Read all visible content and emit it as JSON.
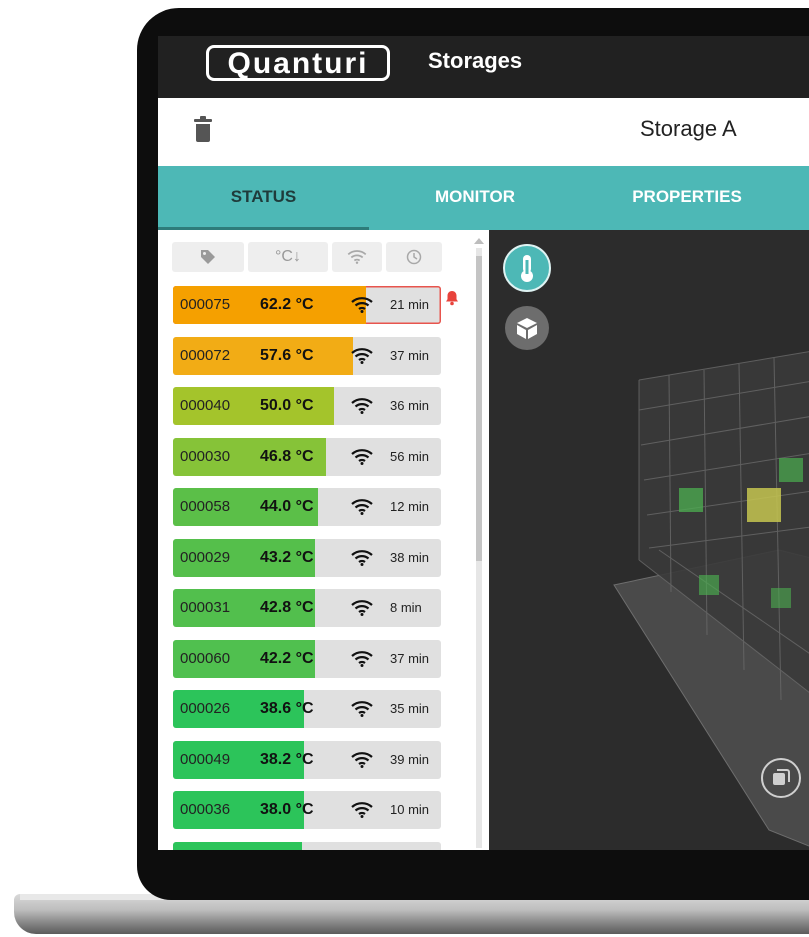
{
  "app": {
    "logo": "Quanturi",
    "title": "Storages"
  },
  "storage": {
    "name": "Storage A"
  },
  "tabs": [
    {
      "label": "STATUS",
      "active": true
    },
    {
      "label": "MONITOR",
      "active": false
    },
    {
      "label": "PROPERTIES",
      "active": false
    }
  ],
  "filters": {
    "temp_sort_label": "°C↓"
  },
  "sensors": [
    {
      "id": "000075",
      "temp": "62.2 °C",
      "time": "21 min",
      "fill": 0.72,
      "color": "#f5a000",
      "alert": true
    },
    {
      "id": "000072",
      "temp": "57.6 °C",
      "time": "37 min",
      "fill": 0.67,
      "color": "#f2ac15",
      "alert": false
    },
    {
      "id": "000040",
      "temp": "50.0 °C",
      "time": "36 min",
      "fill": 0.6,
      "color": "#a4c42b",
      "alert": false
    },
    {
      "id": "000030",
      "temp": "46.8 °C",
      "time": "56 min",
      "fill": 0.57,
      "color": "#86c338",
      "alert": false
    },
    {
      "id": "000058",
      "temp": "44.0 °C",
      "time": "12 min",
      "fill": 0.54,
      "color": "#5bbf48",
      "alert": false
    },
    {
      "id": "000029",
      "temp": "43.2 °C",
      "time": "38 min",
      "fill": 0.53,
      "color": "#55bf4b",
      "alert": false
    },
    {
      "id": "000031",
      "temp": "42.8 °C",
      "time": "8 min",
      "fill": 0.53,
      "color": "#52bf4d",
      "alert": false
    },
    {
      "id": "000060",
      "temp": "42.2 °C",
      "time": "37 min",
      "fill": 0.53,
      "color": "#50c04f",
      "alert": false
    },
    {
      "id": "000026",
      "temp": "38.6 °C",
      "time": "35 min",
      "fill": 0.49,
      "color": "#2cc45a",
      "alert": false
    },
    {
      "id": "000049",
      "temp": "38.2 °C",
      "time": "39 min",
      "fill": 0.49,
      "color": "#2cc45a",
      "alert": false
    },
    {
      "id": "000036",
      "temp": "38.0 °C",
      "time": "10 min",
      "fill": 0.49,
      "color": "#2cc45a",
      "alert": false
    },
    {
      "id": "",
      "temp": "",
      "time": "",
      "fill": 0.48,
      "color": "#2cc45a",
      "alert": false
    }
  ],
  "colors": {
    "accent": "#4db8b6",
    "topbar": "#212121",
    "alert": "#e8544d"
  },
  "icons": [
    "trash-icon",
    "tag-icon",
    "wifi-icon",
    "clock-icon",
    "bell-icon",
    "thermometer-icon",
    "cube-icon",
    "layers-icon"
  ]
}
